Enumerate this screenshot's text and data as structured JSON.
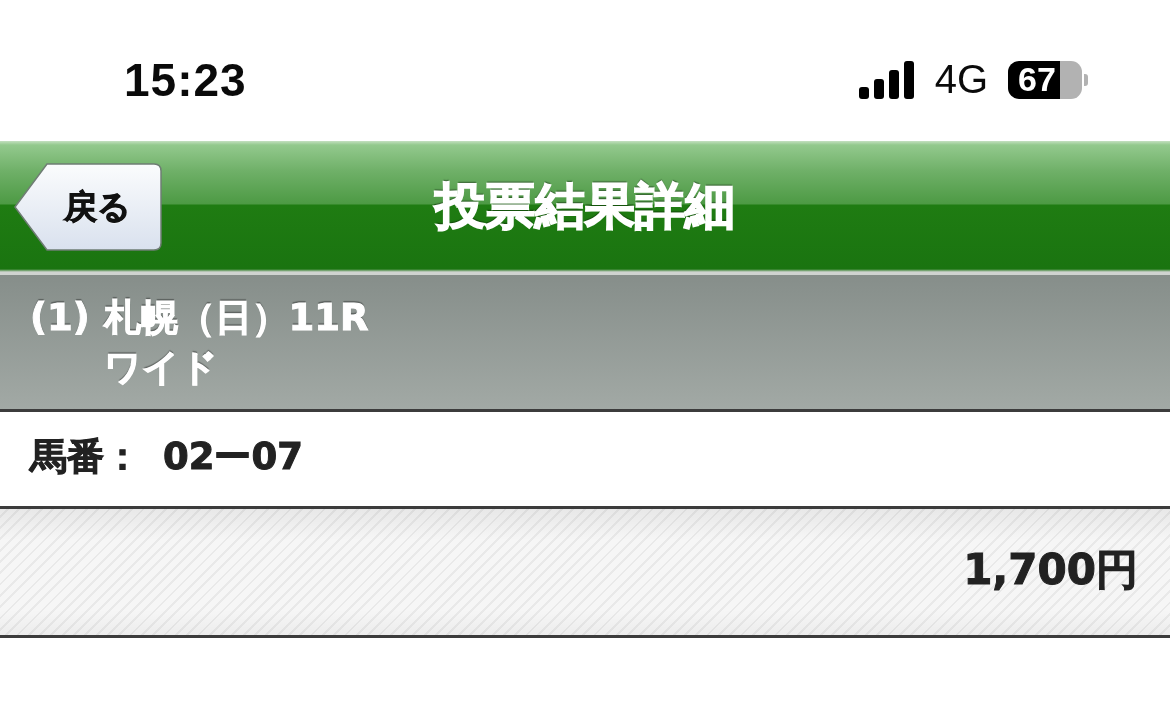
{
  "status_bar": {
    "time": "15:23",
    "network": "4G",
    "battery": "67"
  },
  "nav_bar": {
    "back_button": "戻る",
    "title": "投票結果詳細"
  },
  "bet_header": {
    "number": "(1)",
    "race": "札幌（日）11R",
    "bet_type": "ワイド"
  },
  "horse_numbers": {
    "label": "馬番：",
    "value": "02ー07"
  },
  "amount": "1,700円"
}
